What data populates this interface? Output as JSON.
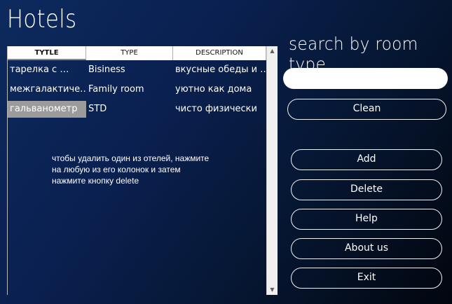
{
  "app": {
    "title": "Hotels"
  },
  "grid": {
    "columns": [
      "TYTLE",
      "TYPE",
      "DESCRIPTION"
    ],
    "rows": [
      [
        "тарелка с …",
        "Bisiness",
        "вкусные обеды и …"
      ],
      [
        "межгалактиче…",
        "Family room",
        "уютно как дома"
      ],
      [
        "гальванометр",
        "STD",
        "чисто физически"
      ]
    ],
    "selected_row": 2
  },
  "hint": {
    "lines": [
      "чтобы удалить один из отелей, нажмите",
      "на любую из его колонок и затем",
      "нажмите кнопку delete"
    ]
  },
  "search": {
    "label": "search by room type",
    "value": "",
    "placeholder": ""
  },
  "buttons": {
    "clean": "Clean",
    "add": "Add",
    "delete": "Delete",
    "help": "Help",
    "about": "About us",
    "exit": "Exit"
  },
  "colors": {
    "background_start": "#0d2a5e",
    "background_end": "#02060e",
    "selected_cell": "#9b9b9b"
  }
}
